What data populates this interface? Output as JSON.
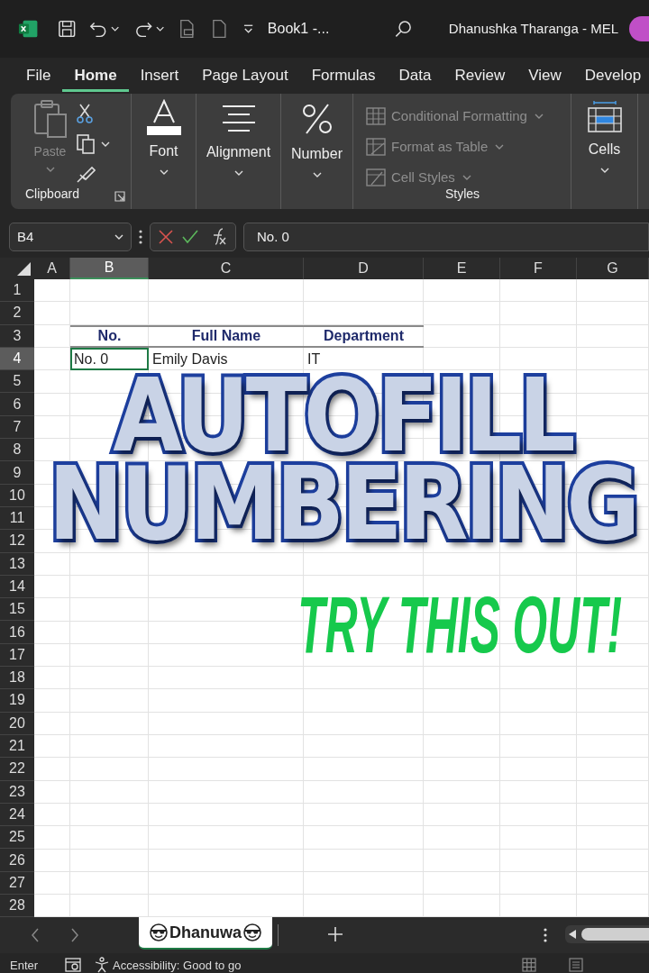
{
  "title_bar": {
    "title": "Book1  -...",
    "account": "Dhanushka Tharanga - MEL"
  },
  "menu_tabs": [
    {
      "label": "File",
      "selected": false
    },
    {
      "label": "Home",
      "selected": true
    },
    {
      "label": "Insert",
      "selected": false
    },
    {
      "label": "Page Layout",
      "selected": false
    },
    {
      "label": "Formulas",
      "selected": false
    },
    {
      "label": "Data",
      "selected": false
    },
    {
      "label": "Review",
      "selected": false
    },
    {
      "label": "View",
      "selected": false
    },
    {
      "label": "Develop",
      "selected": false
    }
  ],
  "ribbon": {
    "clipboard": {
      "paste": "Paste",
      "paste_disabled": true,
      "label": "Clipboard"
    },
    "font": "Font",
    "alignment": "Alignment",
    "number": "Number",
    "styles": {
      "items": [
        {
          "label": "Conditional Formatting",
          "kind": "conditional"
        },
        {
          "label": "Format as Table",
          "kind": "table"
        },
        {
          "label": "Cell Styles",
          "kind": "styles"
        }
      ],
      "label": "Styles"
    },
    "cells": "Cells"
  },
  "formula_bar": {
    "name_box": "B4",
    "formula": "No. 0"
  },
  "sheet": {
    "columns": [
      {
        "label": "A",
        "selected": false
      },
      {
        "label": "B",
        "selected": true
      },
      {
        "label": "C",
        "selected": false
      },
      {
        "label": "D",
        "selected": false
      },
      {
        "label": "E",
        "selected": false
      },
      {
        "label": "F",
        "selected": false
      },
      {
        "label": "G",
        "selected": false
      }
    ],
    "rows": [
      {
        "label": "1",
        "selected": false
      },
      {
        "label": "2",
        "selected": false
      },
      {
        "label": "3",
        "selected": false
      },
      {
        "label": "4",
        "selected": true
      },
      {
        "label": "5",
        "selected": false
      },
      {
        "label": "6",
        "selected": false
      },
      {
        "label": "7",
        "selected": false
      },
      {
        "label": "8",
        "selected": false
      },
      {
        "label": "9",
        "selected": false
      },
      {
        "label": "10",
        "selected": false
      },
      {
        "label": "11",
        "selected": false
      },
      {
        "label": "12",
        "selected": false
      },
      {
        "label": "13",
        "selected": false
      },
      {
        "label": "14",
        "selected": false
      },
      {
        "label": "15",
        "selected": false
      },
      {
        "label": "16",
        "selected": false
      },
      {
        "label": "17",
        "selected": false
      },
      {
        "label": "18",
        "selected": false
      },
      {
        "label": "19",
        "selected": false
      },
      {
        "label": "20",
        "selected": false
      },
      {
        "label": "21",
        "selected": false
      },
      {
        "label": "22",
        "selected": false
      },
      {
        "label": "23",
        "selected": false
      },
      {
        "label": "24",
        "selected": false
      },
      {
        "label": "25",
        "selected": false
      },
      {
        "label": "26",
        "selected": false
      },
      {
        "label": "27",
        "selected": false
      },
      {
        "label": "28",
        "selected": false
      }
    ],
    "table": {
      "columns": [
        "No.",
        "Full Name",
        "Department"
      ],
      "rows": [
        {
          "cells": [
            {
              "text": "No. 0",
              "selected": true
            },
            {
              "text": "Emily Davis",
              "selected": false
            },
            {
              "text": "IT",
              "selected": false
            }
          ]
        }
      ]
    }
  },
  "overlay": {
    "title_lines": [
      "AUTOFILL",
      "NUMBERING"
    ],
    "tagline": "TRY THIS OUT!"
  },
  "sheet_tabs": [
    {
      "label": "Dhanuwa",
      "selected": true
    }
  ],
  "status_bar": {
    "mode": "Enter",
    "accessibility": "Accessibility: Good to go"
  }
}
